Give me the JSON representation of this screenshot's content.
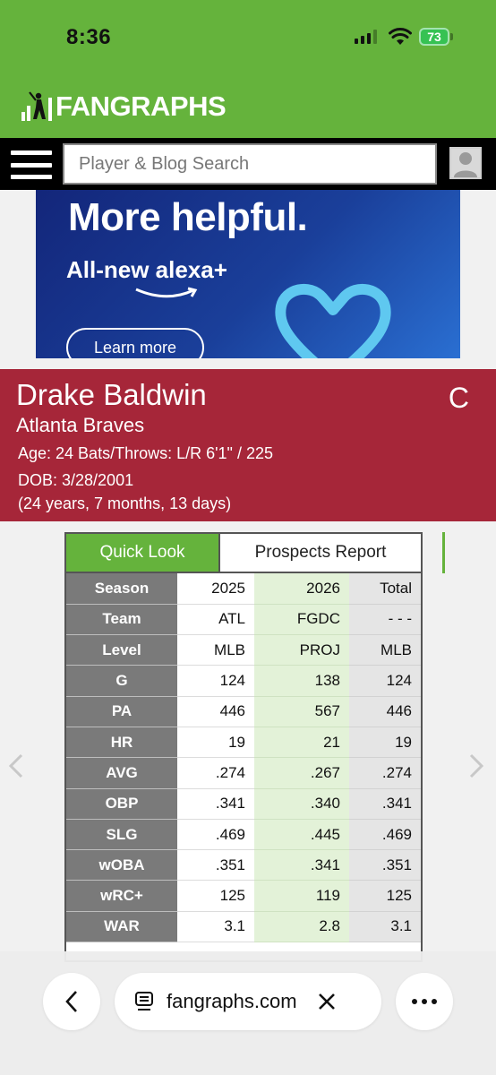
{
  "status_bar": {
    "time": "8:36",
    "battery": "73"
  },
  "site": {
    "logo_text": "FANGRAPHS"
  },
  "search": {
    "placeholder": "Player & Blog Search"
  },
  "ad": {
    "headline": "More helpful.",
    "subline": "All-new alexa+",
    "button": "Learn more"
  },
  "player": {
    "name": "Drake Baldwin",
    "team": "Atlanta Braves",
    "position": "C",
    "bio_line": "Age: 24 Bats/Throws: L/R 6'1\" / 225",
    "dob": "DOB: 3/28/2001",
    "age_detail": "(24 years, 7 months, 13 days)"
  },
  "tabs": {
    "quick_look": "Quick Look",
    "prospects_report": "Prospects Report"
  },
  "stats": {
    "rows": [
      {
        "label": "Season",
        "c1": "2025",
        "c2": "2026",
        "c3": "Total"
      },
      {
        "label": "Team",
        "c1": "ATL",
        "c2": "FGDC",
        "c3": "- - -"
      },
      {
        "label": "Level",
        "c1": "MLB",
        "c2": "PROJ",
        "c3": "MLB"
      },
      {
        "label": "G",
        "c1": "124",
        "c2": "138",
        "c3": "124"
      },
      {
        "label": "PA",
        "c1": "446",
        "c2": "567",
        "c3": "446"
      },
      {
        "label": "HR",
        "c1": "19",
        "c2": "21",
        "c3": "19"
      },
      {
        "label": "AVG",
        "c1": ".274",
        "c2": ".267",
        "c3": ".274"
      },
      {
        "label": "OBP",
        "c1": ".341",
        "c2": ".340",
        "c3": ".341"
      },
      {
        "label": "SLG",
        "c1": ".469",
        "c2": ".445",
        "c3": ".469"
      },
      {
        "label": "wOBA",
        "c1": ".351",
        "c2": ".341",
        "c3": ".351"
      },
      {
        "label": "wRC+",
        "c1": "125",
        "c2": "119",
        "c3": "125"
      },
      {
        "label": "WAR",
        "c1": "3.1",
        "c2": "2.8",
        "c3": "3.1"
      }
    ]
  },
  "browser": {
    "url": "fangraphs.com"
  },
  "colors": {
    "brand_green": "#65b33c",
    "braves_red": "#a62639",
    "label_gray": "#7a7a7a",
    "proj_green": "#e3f2d8"
  }
}
